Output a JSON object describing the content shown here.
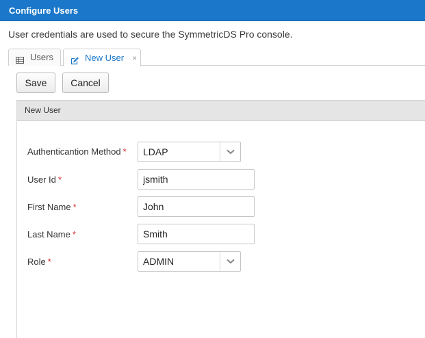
{
  "window": {
    "title": "Configure Users"
  },
  "description": "User credentials are used to secure the SymmetricDS Pro console.",
  "tabs": [
    {
      "label": "Users",
      "icon": "table-icon",
      "active": false
    },
    {
      "label": "New User",
      "icon": "edit-icon",
      "active": true,
      "close": "×"
    }
  ],
  "toolbar": {
    "save_label": "Save",
    "cancel_label": "Cancel"
  },
  "panel": {
    "title": "New User"
  },
  "form": {
    "required_marker": "*",
    "auth_method": {
      "label": "Authenticantion Method",
      "value": "LDAP"
    },
    "user_id": {
      "label": "User Id",
      "value": "jsmith"
    },
    "first_name": {
      "label": "First Name",
      "value": "John"
    },
    "last_name": {
      "label": "Last Name",
      "value": "Smith"
    },
    "role": {
      "label": "Role",
      "value": "ADMIN"
    }
  },
  "colors": {
    "accent": "#1a77c9",
    "required": "#d32f2f",
    "panel_header_bg": "#e5e5e5"
  }
}
